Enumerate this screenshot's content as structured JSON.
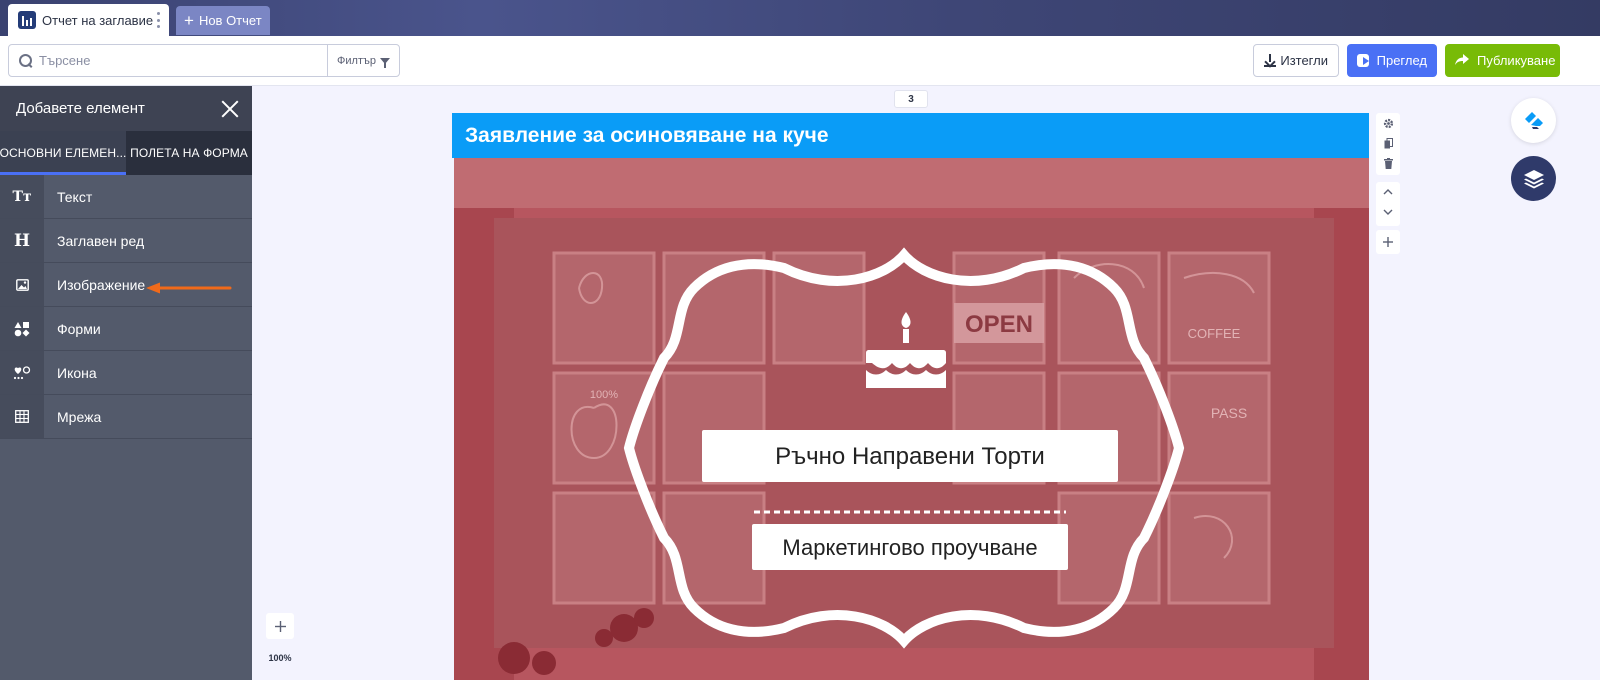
{
  "tabs": {
    "active_label": "Отчет на заглавие",
    "new_label": "Нов Отчет"
  },
  "toolbar": {
    "search_placeholder": "Търсене",
    "filter_label": "Филтър",
    "download_label": "Изтегли",
    "preview_label": "Преглед",
    "publish_label": "Публикуване",
    "colors": {
      "preview": "#4a70f5",
      "publish": "#78bb07"
    }
  },
  "sidebar": {
    "title": "Добавете елемент",
    "tabs": [
      "ОСНОВНИ ЕЛЕМЕН...",
      "ПОЛЕТА НА ФОРМА"
    ],
    "items": [
      {
        "icon": "text-icon",
        "glyph": "Tт",
        "label": "Текст"
      },
      {
        "icon": "heading-icon",
        "glyph": "H",
        "label": "Заглавен ред"
      },
      {
        "icon": "image-icon",
        "glyph": "",
        "label": "Изображение"
      },
      {
        "icon": "shapes-icon",
        "glyph": "",
        "label": "Форми"
      },
      {
        "icon": "icon-icon",
        "glyph": "",
        "label": "Икона"
      },
      {
        "icon": "grid-icon",
        "glyph": "",
        "label": "Мрежа"
      }
    ]
  },
  "canvas": {
    "page_number": "3",
    "form_title": "Заявление за осиновяване на куче",
    "header_color": "#0a9cf7",
    "badge_title": "Ръчно Направени Торти",
    "badge_subtitle": "Маркетингово проучване",
    "window_signs": [
      "OPEN",
      "PASS",
      "COFFEE",
      "100%"
    ],
    "zoom_level": "100%"
  }
}
